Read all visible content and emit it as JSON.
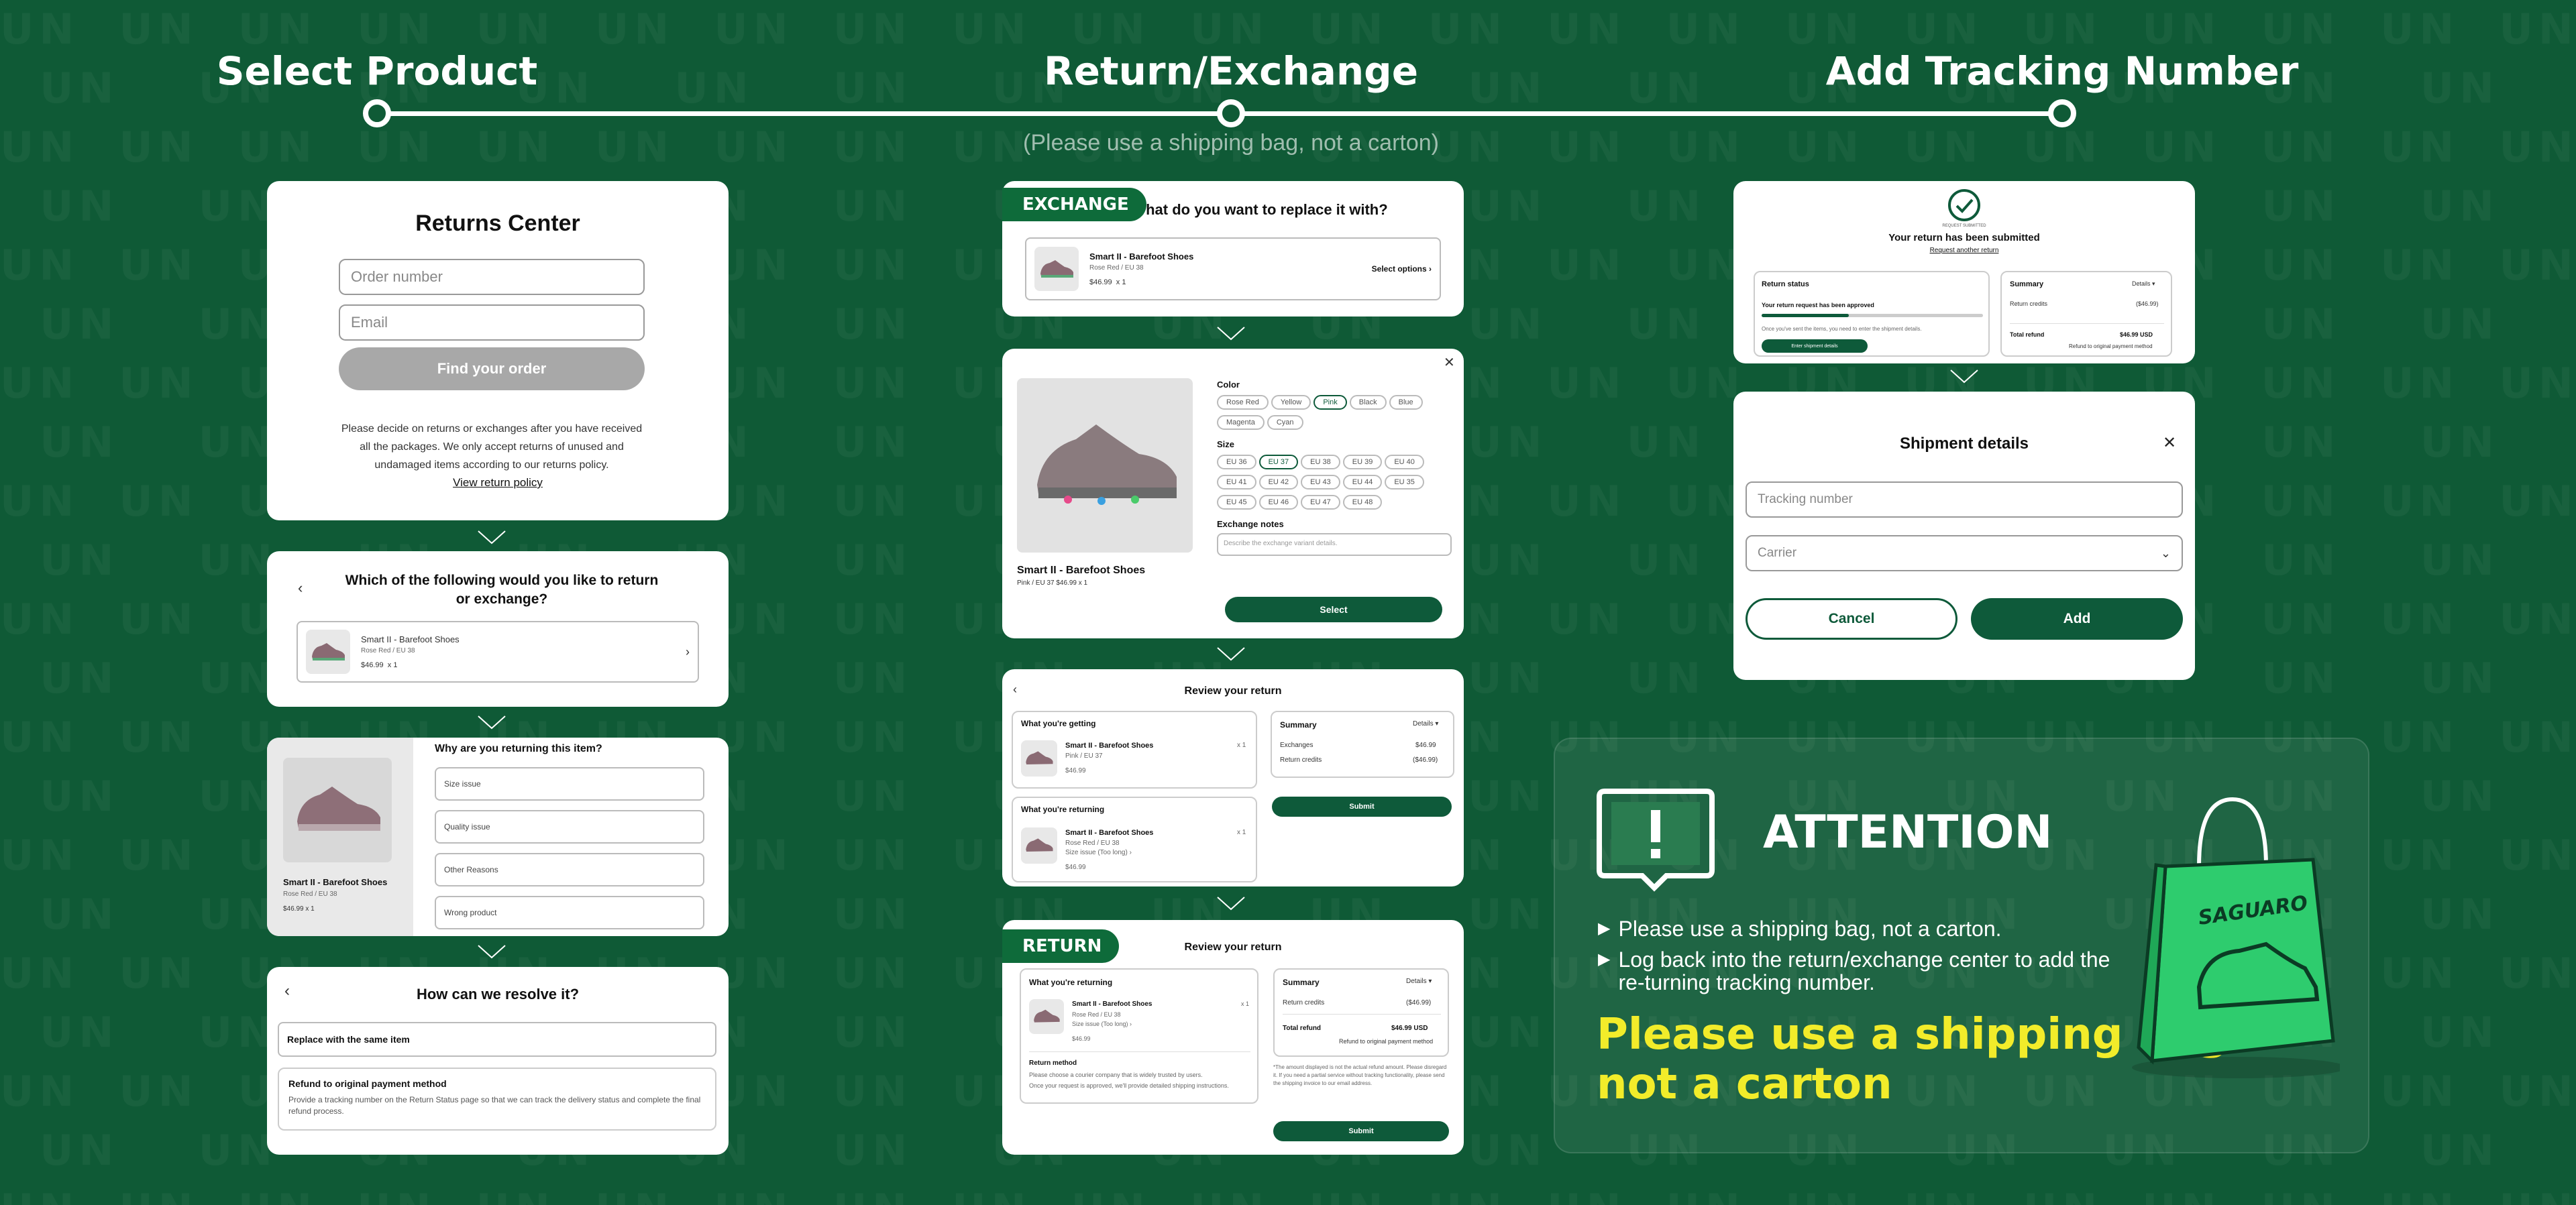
{
  "steps": {
    "step1": "Select Product",
    "step2": "Return/Exchange",
    "step3": "Add Tracking Number",
    "note": "(Please use a shipping bag, not a carton)"
  },
  "returns_center": {
    "title": "Returns Center",
    "order_placeholder": "Order number",
    "email_placeholder": "Email",
    "find_button": "Find your order",
    "policy_text": "Please decide on returns or exchanges after you have received all the packages. We only accept returns of unused and undamaged items according to our returns policy.",
    "policy_link": "View return policy"
  },
  "select_item": {
    "title": "Which of the following would you like to return or exchange?",
    "product_name": "Smart II - Barefoot Shoes",
    "variant": "Rose Red / EU 38",
    "price": "$46.99",
    "qty": "x 1"
  },
  "reason": {
    "title": "Why are you returning this item?",
    "product_name": "Smart II - Barefoot Shoes",
    "variant": "Rose Red / EU 38",
    "price": "$46.99 x 1",
    "options": [
      "Size issue",
      "Quality issue",
      "Other Reasons",
      "Wrong product"
    ]
  },
  "resolve": {
    "title": "How can we resolve it?",
    "option1": "Replace with the same item",
    "option2_title": "Refund to original payment method",
    "option2_desc": "Provide a tracking number on the Return Status page so that we can track the delivery status and complete the final refund process."
  },
  "exchange_card": {
    "tag": "EXCHANGE",
    "title": "What do you want to replace it with?",
    "product_name": "Smart II - Barefoot Shoes",
    "variant": "Rose Red / EU 38",
    "price": "$46.99",
    "qty": "x 1",
    "select_options": "Select options"
  },
  "options_card": {
    "color_label": "Color",
    "colors": [
      "Rose Red",
      "Yellow",
      "Pink",
      "Black",
      "Blue",
      "Magenta",
      "Cyan"
    ],
    "size_label": "Size",
    "sizes": [
      "EU 36",
      "EU 37",
      "EU 38",
      "EU 39",
      "EU 40",
      "EU 41",
      "EU 42",
      "EU 43",
      "EU 44",
      "EU 35",
      "EU 45",
      "EU 46",
      "EU 47",
      "EU 48"
    ],
    "notes_label": "Exchange notes",
    "notes_placeholder": "Describe the exchange variant details.",
    "select_button": "Select",
    "product_name": "Smart II - Barefoot Shoes",
    "variant_price": "Pink / EU 37   $46.99 x 1"
  },
  "review_exchange": {
    "title": "Review your return",
    "getting_label": "What you're getting",
    "getting_name": "Smart II - Barefoot Shoes",
    "getting_variant": "Pink / EU 37",
    "getting_price": "$46.99",
    "getting_qty": "x 1",
    "returning_label": "What you're returning",
    "returning_name": "Smart II - Barefoot Shoes",
    "returning_variant": "Rose Red / EU 38",
    "returning_reason": "Size issue (Too long)",
    "returning_price": "$46.99",
    "returning_qty": "x 1",
    "summary_label": "Summary",
    "details": "Details",
    "exchanges_label": "Exchanges",
    "exchanges_value": "$46.99",
    "credits_label": "Return credits",
    "credits_value": "($46.99)",
    "submit": "Submit"
  },
  "review_return": {
    "tag": "RETURN",
    "title": "Review your return",
    "returning_label": "What you're returning",
    "name": "Smart II - Barefoot Shoes",
    "variant": "Rose Red / EU 38",
    "reason": "Size issue (Too long)",
    "price": "$46.99",
    "qty": "x 1",
    "method_label": "Return method",
    "method_line1": "Please choose a courier company that is widely trusted by users.",
    "method_line2": "Once your request is approved, we'll provide detailed shipping instructions.",
    "summary_label": "Summary",
    "details": "Details",
    "credits_label": "Return credits",
    "credits_value": "($46.99)",
    "total_label": "Total refund",
    "total_value": "$46.99 USD",
    "refund_to": "Refund to original payment method",
    "disclaimer": "*The amount displayed is not the actual refund amount. Please disregard it. If you need a partial service without tracking functionality, please send the shipping invoice to our email address.",
    "submit": "Submit"
  },
  "submitted": {
    "small_caption": "REQUEST SUBMITTED",
    "title": "Your return has been submitted",
    "link": "Request another return",
    "status_label": "Return status",
    "status_text": "Your return request has been approved",
    "status_desc": "Once you've sent the items, you need to enter the shipment details.",
    "enter_button": "Enter shipment details",
    "summary_label": "Summary",
    "details": "Details",
    "credits_label": "Return credits",
    "credits_value": "($46.99)",
    "total_label": "Total refund",
    "total_value": "$46.99 USD",
    "refund_to": "Refund to original payment method"
  },
  "shipment": {
    "title": "Shipment details",
    "tracking_placeholder": "Tracking number",
    "carrier_placeholder": "Carrier",
    "cancel": "Cancel",
    "add": "Add"
  },
  "attention": {
    "title": "ATTENTION",
    "bullet1": "Please use a shipping bag, not a carton.",
    "bullet2": "Log back into the return/exchange center to add the re-turning tracking number.",
    "highlight_line1": "Please use a shipping bag",
    "highlight_line2": "not a carton",
    "bag_brand": "SAGUARO"
  },
  "colors": {
    "background": "#0f5a36",
    "brand_green": "#0e5a3a",
    "highlight_yellow": "#f2ec2a",
    "bag_green": "#2ecc6e"
  }
}
